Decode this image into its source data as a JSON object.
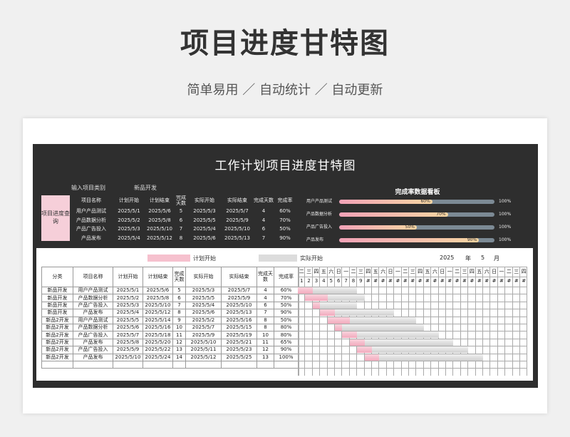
{
  "page": {
    "title": "项目进度甘特图",
    "subtitle": "简单易用 ／ 自动统计 ／ 自动更新"
  },
  "sheet": {
    "title": "工作计划项目进度甘特图",
    "input_label": "输入项目类别",
    "input_value": "新品开发",
    "query_label": "项目进度查询"
  },
  "summary_table": {
    "headers": [
      "项目名称",
      "计划开始",
      "计划结束",
      "完成天数",
      "实际开始",
      "实际结束",
      "完成天数",
      "完成率"
    ],
    "rows": [
      [
        "用户产品测试",
        "2025/5/1",
        "2025/5/6",
        "5",
        "2025/5/3",
        "2025/5/7",
        "4",
        "60%"
      ],
      [
        "产品数据分析",
        "2025/5/2",
        "2025/5/8",
        "6",
        "2025/5/5",
        "2025/5/9",
        "4",
        "70%"
      ],
      [
        "产品广告投入",
        "2025/5/3",
        "2025/5/10",
        "7",
        "2025/5/4",
        "2025/5/10",
        "6",
        "50%"
      ],
      [
        "产品发布",
        "2025/5/4",
        "2025/5/12",
        "8",
        "2025/5/6",
        "2025/5/13",
        "7",
        "90%"
      ]
    ]
  },
  "dashboard": {
    "title": "完成率数据看板",
    "items": [
      {
        "label": "用户产品测试",
        "value": 60,
        "pct": "60%",
        "total": "100%"
      },
      {
        "label": "产品数据分析",
        "value": 70,
        "pct": "70%",
        "total": "100%"
      },
      {
        "label": "产品广告投入",
        "value": 50,
        "pct": "50%",
        "total": "100%"
      },
      {
        "label": "产品发布",
        "value": 90,
        "pct": "90%",
        "total": "100%"
      }
    ]
  },
  "legend": {
    "plan_label": "计划开始",
    "actual_label": "实际开始",
    "year": "2025",
    "year_unit": "年",
    "month": "5",
    "month_unit": "月"
  },
  "main_table": {
    "headers": [
      "分类",
      "项目名称",
      "计划开始",
      "计划结束",
      "完成天数",
      "实际开始",
      "实际结束",
      "完成天数",
      "完成率"
    ],
    "rows": [
      [
        "新品开发",
        "用户产品测试",
        "2025/5/1",
        "2025/5/6",
        "5",
        "2025/5/3",
        "2025/5/7",
        "4",
        "60%"
      ],
      [
        "新品开发",
        "产品数据分析",
        "2025/5/2",
        "2025/5/8",
        "6",
        "2025/5/5",
        "2025/5/9",
        "4",
        "70%"
      ],
      [
        "新品开发",
        "产品广告投入",
        "2025/5/3",
        "2025/5/10",
        "7",
        "2025/5/4",
        "2025/5/10",
        "6",
        "50%"
      ],
      [
        "新品开发",
        "产品发布",
        "2025/5/4",
        "2025/5/12",
        "8",
        "2025/5/6",
        "2025/5/13",
        "7",
        "90%"
      ],
      [
        "新品2开发",
        "用户产品测试",
        "2025/5/5",
        "2025/5/14",
        "9",
        "2025/5/2",
        "2025/5/16",
        "8",
        "50%"
      ],
      [
        "新品2开发",
        "产品数据分析",
        "2025/5/6",
        "2025/5/16",
        "10",
        "2025/5/7",
        "2025/5/15",
        "8",
        "80%"
      ],
      [
        "新品2开发",
        "产品广告投入",
        "2025/5/7",
        "2025/5/18",
        "11",
        "2025/5/9",
        "2025/5/19",
        "10",
        "80%"
      ],
      [
        "新品2开发",
        "产品发布",
        "2025/5/8",
        "2025/5/20",
        "12",
        "2025/5/10",
        "2025/5/21",
        "11",
        "65%"
      ],
      [
        "新品2开发",
        "产品广告投入",
        "2025/5/9",
        "2025/5/22",
        "13",
        "2025/5/11",
        "2025/5/23",
        "12",
        "90%"
      ],
      [
        "新品2开发",
        "产品发布",
        "2025/5/10",
        "2025/5/24",
        "14",
        "2025/5/12",
        "2025/5/25",
        "13",
        "100%"
      ],
      [
        "",
        "",
        "",
        "",
        "",
        "",
        "",
        "",
        ""
      ]
    ]
  },
  "gantt": {
    "weekdays": [
      "二",
      "三",
      "四",
      "五",
      "六",
      "日",
      "一",
      "二",
      "三",
      "四",
      "五",
      "六",
      "日",
      "一",
      "二",
      "三",
      "四",
      "五",
      "六",
      "日",
      "一",
      "二",
      "三",
      "四",
      "五",
      "六",
      "日",
      "一",
      "二",
      "三",
      "四"
    ],
    "days": [
      "1",
      "2",
      "3",
      "4",
      "5",
      "6",
      "7",
      "8",
      "9",
      "#",
      "#",
      "#",
      "#",
      "#",
      "#",
      "#",
      "#",
      "#",
      "#",
      "#",
      "#",
      "#",
      "#",
      "#",
      "#",
      "#",
      "#",
      "#",
      "#",
      "#",
      "#"
    ],
    "bars": [
      {
        "plan_start": 1,
        "plan_days": 2,
        "actual_start": 3,
        "actual_days": 6
      },
      {
        "plan_start": 2,
        "plan_days": 3,
        "actual_start": 5,
        "actual_days": 5
      },
      {
        "plan_start": 3,
        "plan_days": 1,
        "actual_start": 4,
        "actual_days": 5
      },
      {
        "plan_start": 4,
        "plan_days": 2,
        "actual_start": 6,
        "actual_days": 8
      },
      {
        "plan_start": 5,
        "plan_days": 3,
        "actual_start": 8,
        "actual_days": 9
      },
      {
        "plan_start": 6,
        "plan_days": 1,
        "actual_start": 7,
        "actual_days": 11
      },
      {
        "plan_start": 7,
        "plan_days": 2,
        "actual_start": 9,
        "actual_days": 11
      },
      {
        "plan_start": 8,
        "plan_days": 2,
        "actual_start": 10,
        "actual_days": 12
      },
      {
        "plan_start": 9,
        "plan_days": 2,
        "actual_start": 11,
        "actual_days": 13
      },
      {
        "plan_start": 10,
        "plan_days": 2,
        "actual_start": 12,
        "actual_days": 14
      }
    ]
  }
}
